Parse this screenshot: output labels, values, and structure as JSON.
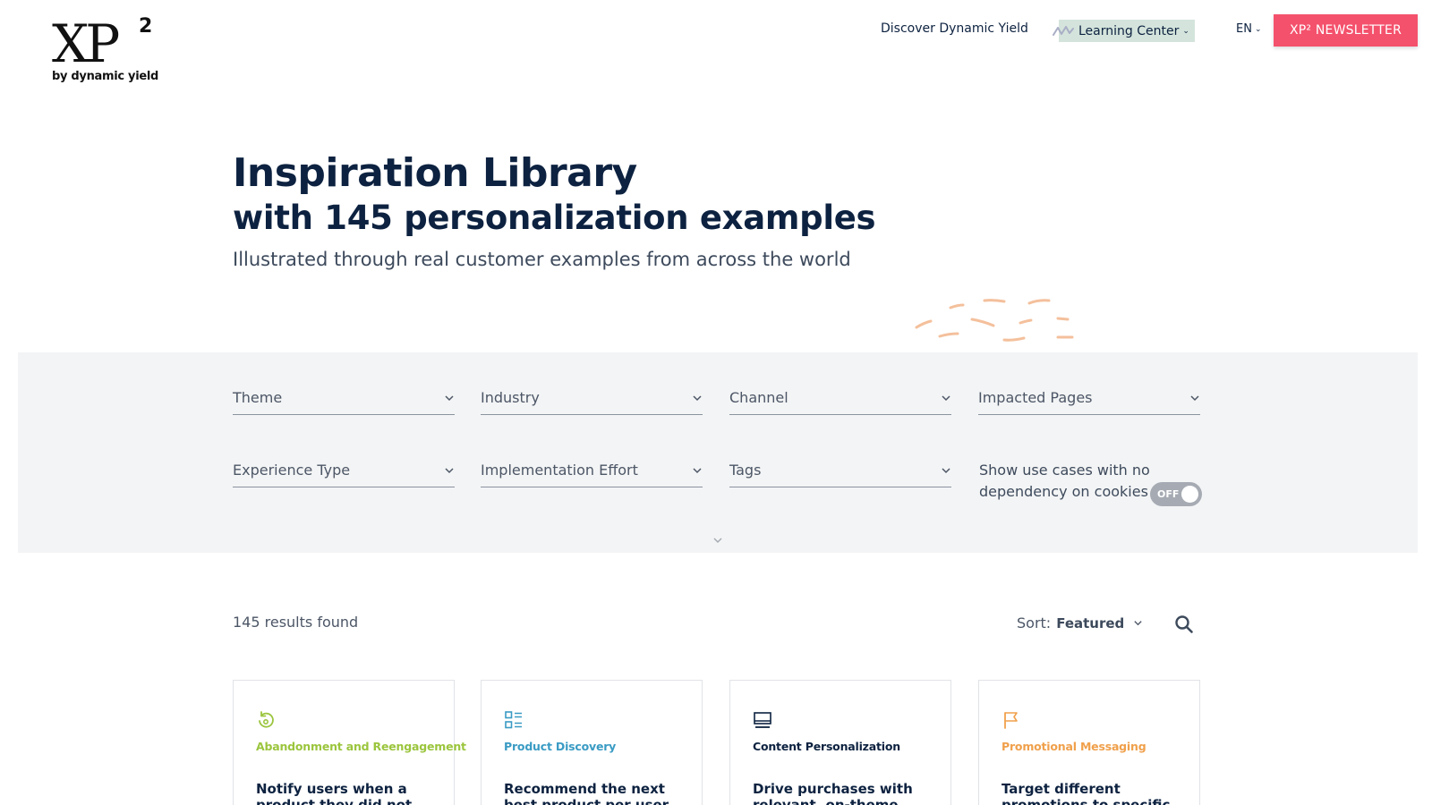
{
  "header": {
    "logo": {
      "mark": "XP",
      "superscript": "2",
      "byline": "by dynamic yield"
    },
    "nav": {
      "discover": "Discover Dynamic Yield",
      "learning_center": "Learning Center",
      "language": "EN"
    },
    "newsletter_button": "XP² NEWSLETTER"
  },
  "hero": {
    "title": "Inspiration Library",
    "subtitle": "with 145 personalization examples",
    "description": "Illustrated through real customer examples from across the world"
  },
  "filters": {
    "theme": "Theme",
    "industry": "Industry",
    "channel": "Channel",
    "impacted_pages": "Impacted Pages",
    "experience_type": "Experience Type",
    "implementation_effort": "Implementation Effort",
    "tags": "Tags",
    "cookie_toggle_label": "Show use cases with no dependency on cookies",
    "cookie_toggle_state": "OFF"
  },
  "results": {
    "count_text": "145 results found",
    "sort_label": "Sort:",
    "sort_value": "Featured"
  },
  "cards": [
    {
      "icon": "reengage-icon",
      "category": "Abandonment and Reengagement",
      "category_color": "#9bc53d",
      "title": "Notify users when a product they did not end"
    },
    {
      "icon": "list-icon",
      "category": "Product Discovery",
      "category_color": "#3a9bc4",
      "title": "Recommend the next best product per user with"
    },
    {
      "icon": "monitor-icon",
      "category": "Content Personalization",
      "category_color": "#0d2240",
      "title": "Drive purchases with relevant, on-theme"
    },
    {
      "icon": "flag-icon",
      "category": "Promotional Messaging",
      "category_color": "#f0a04b",
      "title": "Target different promotions to specific"
    }
  ],
  "colors": {
    "brand_navy": "#0d2240",
    "newsletter_pink": "#f4516c",
    "learning_center_bg": "#d4e4dc",
    "filter_panel_bg": "#f3f4f5",
    "squiggle_peach": "#f4c09c"
  }
}
